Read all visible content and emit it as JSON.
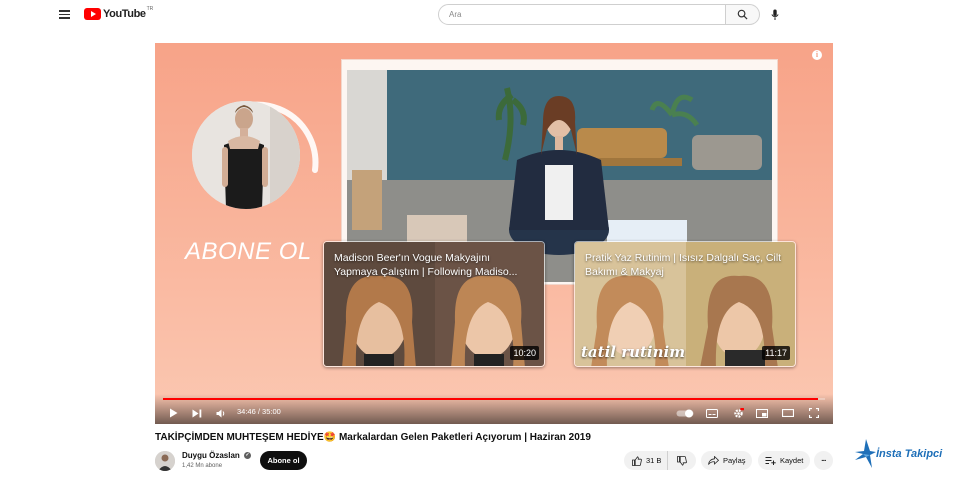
{
  "header": {
    "logo_text": "YouTube",
    "logo_tr": "TR",
    "search_placeholder": "Ara"
  },
  "player": {
    "subscribe_overlay": "ABONE OL",
    "info": "i",
    "progress_fraction": 0.99,
    "time": "34:46 / 35:00",
    "endcards": [
      {
        "title": "Madison Beer'ın Vogue Makyajını Yapmaya Çalıştım | Following Madiso...",
        "duration": "10:20"
      },
      {
        "title": "Pratik Yaz Rutinim | Isısız Dalgalı Saç, Cilt Bakımı & Makyaj",
        "duration": "11:17",
        "overlay_text": "tatil rutinim"
      }
    ]
  },
  "video": {
    "title": "TAKİPÇİMDEN MUHTEŞEM HEDİYE🤩 Markalardan Gelen Paketleri Açıyorum | Haziran 2019"
  },
  "channel": {
    "name": "Duygu Özaslan",
    "subscribers": "1,42 Mn abone",
    "subscribe_label": "Abone ol"
  },
  "actions": {
    "likes": "31 B",
    "share_label": "Paylaş",
    "save_label": "Kaydet",
    "more": "···"
  },
  "watermark": {
    "text": "İnsta Takipci"
  },
  "colors": {
    "youtube_red": "#ff0000",
    "player_bg": "#f9b39a",
    "watermark_blue": "#1e6fb8"
  }
}
